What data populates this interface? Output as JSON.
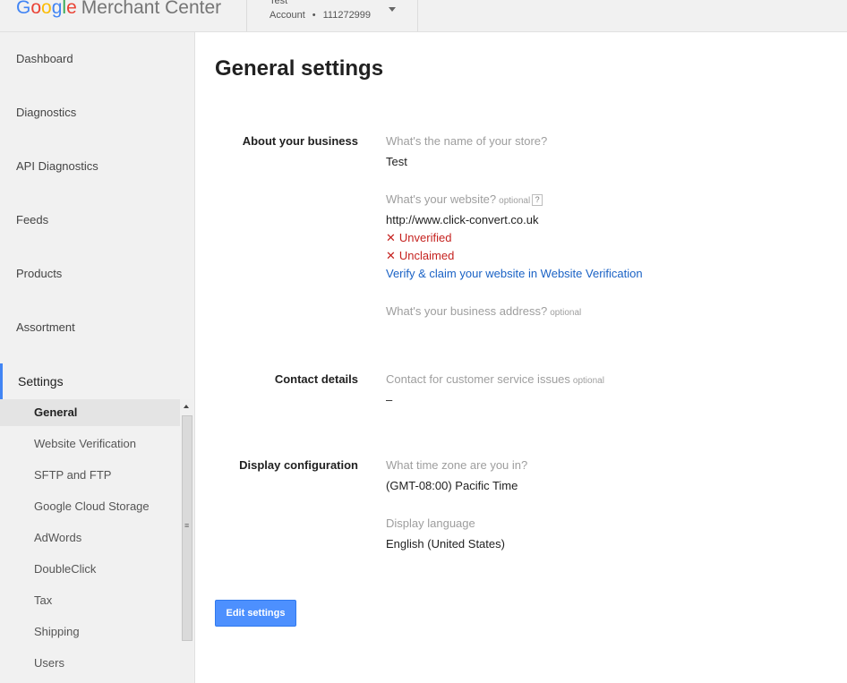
{
  "header": {
    "logo_word": "Google",
    "product": "Merchant Center",
    "account_name": "Test",
    "account_label": "Account",
    "account_id": "111272999"
  },
  "sidebar": {
    "items": [
      {
        "label": "Dashboard"
      },
      {
        "label": "Diagnostics"
      },
      {
        "label": "API Diagnostics"
      },
      {
        "label": "Feeds"
      },
      {
        "label": "Products"
      },
      {
        "label": "Assortment"
      },
      {
        "label": "Settings"
      }
    ],
    "subitems": [
      {
        "label": "General",
        "selected": true
      },
      {
        "label": "Website Verification"
      },
      {
        "label": "SFTP and FTP"
      },
      {
        "label": "Google Cloud Storage"
      },
      {
        "label": "AdWords"
      },
      {
        "label": "DoubleClick"
      },
      {
        "label": "Tax"
      },
      {
        "label": "Shipping"
      },
      {
        "label": "Users"
      }
    ]
  },
  "main": {
    "title": "General settings",
    "about": {
      "heading": "About your business",
      "store_question": "What's the name of your store?",
      "store_value": "Test",
      "website_question": "What's your website?",
      "optional": "optional",
      "help": "?",
      "website_value": "http://www.click-convert.co.uk",
      "status_unverified": "Unverified",
      "status_unclaimed": "Unclaimed",
      "verify_link": "Verify & claim your website in Website Verification",
      "address_question": "What's your business address?"
    },
    "contact": {
      "heading": "Contact details",
      "question": "Contact for customer service issues",
      "value": "–"
    },
    "display": {
      "heading": "Display configuration",
      "timezone_question": "What time zone are you in?",
      "timezone_value": "(GMT-08:00) Pacific Time",
      "language_question": "Display language",
      "language_value": "English (United States)"
    },
    "edit_button": "Edit settings"
  },
  "colors": {
    "accent": "#4285f4",
    "error": "#c5221f",
    "link": "#1a62c5",
    "button": "#4d90fe"
  }
}
